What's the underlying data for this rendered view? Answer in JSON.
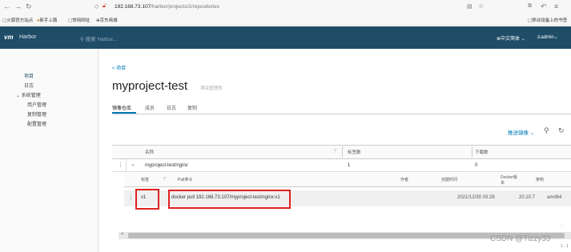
{
  "browser": {
    "url_host": "192.168.73.107",
    "url_path": "/harbor/projects/2/repositories",
    "bookmarks": [
      "火狐官方站点",
      "新手上路",
      "常用网址",
      "京东商城"
    ],
    "mobile_bookmarks": "移动设备上的书签"
  },
  "header": {
    "logo": "vm",
    "product": "Harbor",
    "search_placeholder": "搜索 Harbor...",
    "language": "中文简体",
    "user": "admin"
  },
  "sidebar": {
    "projects": "项目",
    "logs": "日志",
    "admin": "系统管理",
    "admin_items": [
      "用户管理",
      "复制管理",
      "配置管理"
    ]
  },
  "main": {
    "back": "< 项目",
    "title": "myproject-test",
    "role": "项目管理员",
    "tabs": [
      "镜像仓库",
      "成员",
      "日志",
      "复制"
    ],
    "push_button": "推送镜像"
  },
  "repo_table": {
    "headers": [
      "名称",
      "标签数",
      "下载数"
    ],
    "row": {
      "name": "myproject-test/nginx",
      "tags": "1",
      "pulls": "0"
    }
  },
  "tag_table": {
    "headers": [
      "标签",
      "Pull命令",
      "作者",
      "创建时间",
      "Docker版本",
      "架构"
    ],
    "row": {
      "tag": "v1",
      "pull": "docker pull 192.168.73.107/myproject-test/nginx:v1",
      "created": "2021/12/30 03:28",
      "docker": "20.10.7",
      "arch": "amd64"
    },
    "pager": "1 - 1"
  },
  "watermark": "CSDN @Tizzy33"
}
